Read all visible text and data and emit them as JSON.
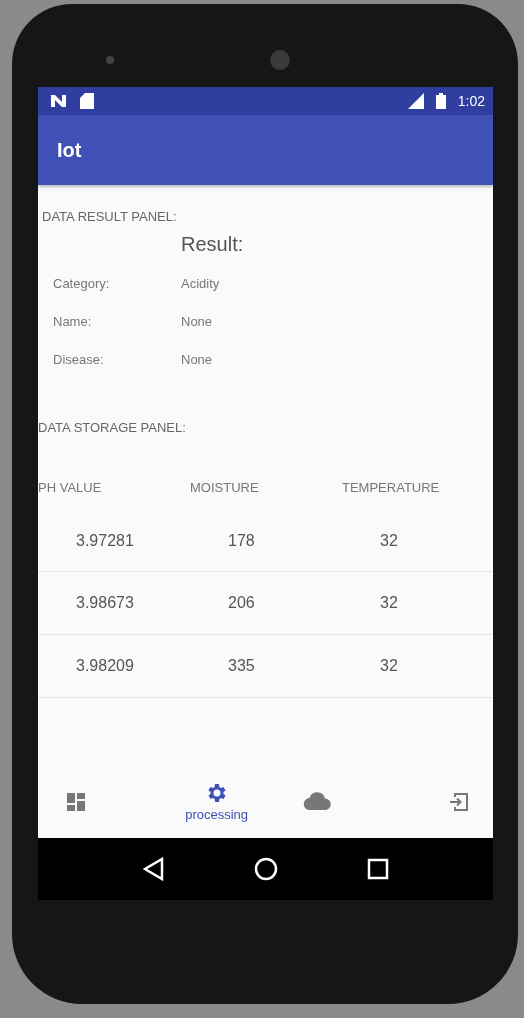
{
  "status_bar": {
    "time": "1:02"
  },
  "app_bar": {
    "title": "Iot"
  },
  "result_panel": {
    "heading": "DATA RESULT PANEL:",
    "title": "Result:",
    "fields": [
      {
        "label": "Category:",
        "value": "Acidity"
      },
      {
        "label": "Name:",
        "value": "None"
      },
      {
        "label": "Disease:",
        "value": "None"
      }
    ]
  },
  "storage_panel": {
    "heading": "DATA STORAGE PANEL:",
    "columns": [
      "PH VALUE",
      "MOISTURE",
      "TEMPERATURE"
    ],
    "rows": [
      [
        "3.97281",
        "178",
        "32"
      ],
      [
        "3.98673",
        "206",
        "32"
      ],
      [
        "3.98209",
        "335",
        "32"
      ]
    ]
  },
  "bottom_nav": [
    {
      "selected": false
    },
    {
      "selected": true,
      "label": "processing"
    },
    {
      "selected": false
    },
    {
      "selected": false
    }
  ]
}
